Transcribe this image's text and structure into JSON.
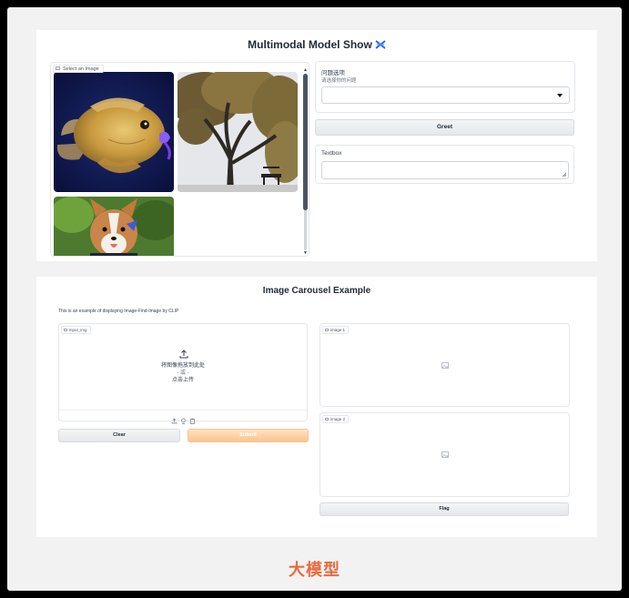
{
  "app1": {
    "title": "Multimodal Model Show",
    "gallery": {
      "label": "Select an Image",
      "items": [
        "goldfish",
        "tree",
        "corgi"
      ]
    },
    "dropdown": {
      "label": "问题选项",
      "info": "请选择你的问题",
      "value": ""
    },
    "greet_label": "Greet",
    "textbox": {
      "label": "Textbox",
      "value": ""
    }
  },
  "app2": {
    "title": "Image Carousel Example",
    "description": "This is an example of displaying Image-Find-Image by CLIP",
    "input": {
      "label": "input_img",
      "drop_text": "将图像拖放到此处",
      "or_text": "- 或 -",
      "click_text": "点击上传"
    },
    "clear_label": "Clear",
    "submit_label": "Submit",
    "image1_label": "image 1",
    "image2_label": "image 2",
    "flag_label": "Flag"
  },
  "watermark": "大模型",
  "colors": {
    "accent": "#fbc48d",
    "watermark": "#ea6a3d",
    "background": "#f2f2f2"
  }
}
